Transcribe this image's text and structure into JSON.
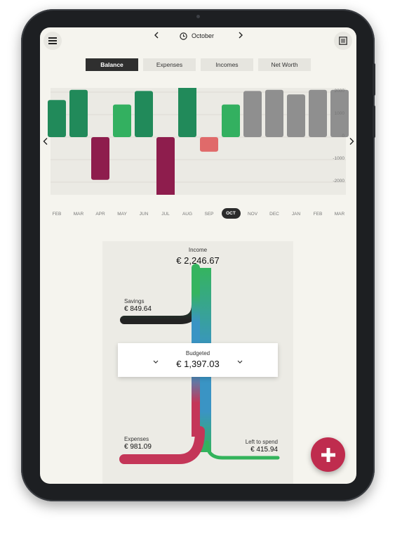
{
  "header": {
    "month": "October",
    "prev_icon": "chevron-left-icon",
    "next_icon": "chevron-right-icon",
    "menu_icon": "hamburger-menu-icon",
    "report_icon": "document-list-icon"
  },
  "tabs": [
    {
      "label": "Balance",
      "active": true
    },
    {
      "label": "Expenses",
      "active": false
    },
    {
      "label": "Incomes",
      "active": false
    },
    {
      "label": "Net Worth",
      "active": false
    }
  ],
  "chart_data": {
    "type": "bar",
    "categories": [
      "FEB",
      "MAR",
      "APR",
      "MAY",
      "JUN",
      "JUL",
      "AUG",
      "SEP",
      "OCT",
      "NOV",
      "DEC",
      "JAN",
      "FEB",
      "MAR"
    ],
    "active_category": "OCT",
    "values": [
      1650,
      2100,
      -1900,
      1450,
      2050,
      -2800,
      2400,
      -650,
      1450,
      2050,
      2100,
      1900,
      2100,
      2100
    ],
    "bar_kinds": [
      "income",
      "income",
      "expense",
      "income",
      "income",
      "expense",
      "income",
      "deficit",
      "income",
      "forecast",
      "forecast",
      "forecast",
      "forecast",
      "forecast"
    ],
    "colors": {
      "income": "#218a5a",
      "income_light": "#33b060",
      "expense": "#8e1d4d",
      "deficit": "#e06a6a",
      "forecast": "#8f8f8f"
    },
    "yticks": [
      "2000",
      "1000",
      "0",
      "-1000",
      "-2000"
    ],
    "ylim": [
      -2500,
      2500
    ],
    "grid": true
  },
  "flow": {
    "income_label": "Income",
    "income_value": "€ 2,246.67",
    "savings_label": "Savings",
    "savings_value": "€ 849.64",
    "budgeted_label": "Budgeted",
    "budgeted_value": "€ 1,397.03",
    "expenses_label": "Expenses",
    "expenses_value": "€ 981.09",
    "left_label": "Left to spend",
    "left_value": "€ 415.94",
    "colors": {
      "income": "#35b45f",
      "savings": "#232323",
      "budget": "#3a94c4",
      "expenses": "#c43658",
      "left": "#33b35b"
    }
  },
  "fab_icon": "plus-icon"
}
